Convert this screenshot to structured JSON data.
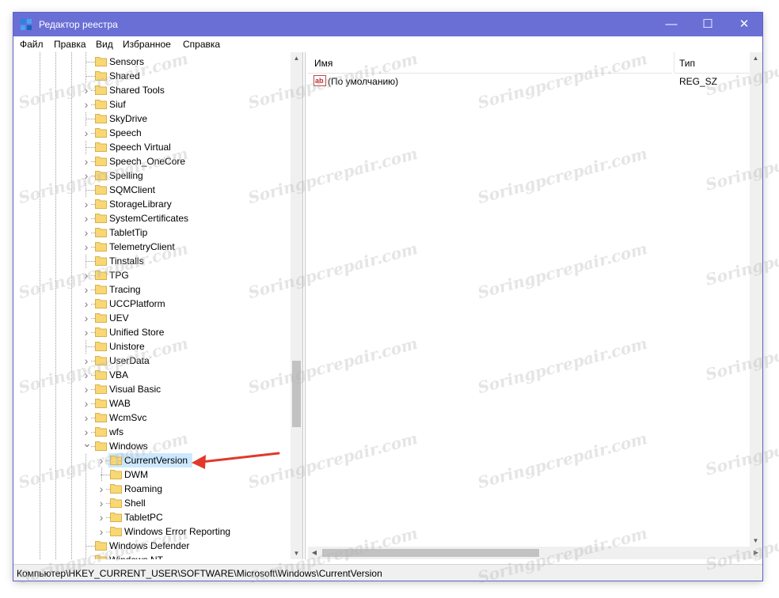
{
  "window": {
    "title": "Редактор реестра"
  },
  "menu": [
    "Файл",
    "Правка",
    "Вид",
    "Избранное",
    "Справка"
  ],
  "tree": {
    "items": [
      {
        "label": "Sensors",
        "level": 0,
        "expander": "none"
      },
      {
        "label": "Shared",
        "level": 0,
        "expander": "none"
      },
      {
        "label": "Shared Tools",
        "level": 0,
        "expander": "collapsed"
      },
      {
        "label": "Siuf",
        "level": 0,
        "expander": "collapsed"
      },
      {
        "label": "SkyDrive",
        "level": 0,
        "expander": "none"
      },
      {
        "label": "Speech",
        "level": 0,
        "expander": "collapsed"
      },
      {
        "label": "Speech Virtual",
        "level": 0,
        "expander": "none"
      },
      {
        "label": "Speech_OneCore",
        "level": 0,
        "expander": "collapsed"
      },
      {
        "label": "Spelling",
        "level": 0,
        "expander": "collapsed"
      },
      {
        "label": "SQMClient",
        "level": 0,
        "expander": "none"
      },
      {
        "label": "StorageLibrary",
        "level": 0,
        "expander": "collapsed"
      },
      {
        "label": "SystemCertificates",
        "level": 0,
        "expander": "collapsed"
      },
      {
        "label": "TabletTip",
        "level": 0,
        "expander": "collapsed"
      },
      {
        "label": "TelemetryClient",
        "level": 0,
        "expander": "collapsed"
      },
      {
        "label": "Tinstalls",
        "level": 0,
        "expander": "none"
      },
      {
        "label": "TPG",
        "level": 0,
        "expander": "collapsed"
      },
      {
        "label": "Tracing",
        "level": 0,
        "expander": "collapsed"
      },
      {
        "label": "UCCPlatform",
        "level": 0,
        "expander": "collapsed"
      },
      {
        "label": "UEV",
        "level": 0,
        "expander": "collapsed"
      },
      {
        "label": "Unified Store",
        "level": 0,
        "expander": "collapsed"
      },
      {
        "label": "Unistore",
        "level": 0,
        "expander": "none"
      },
      {
        "label": "UserData",
        "level": 0,
        "expander": "collapsed"
      },
      {
        "label": "VBA",
        "level": 0,
        "expander": "collapsed"
      },
      {
        "label": "Visual Basic",
        "level": 0,
        "expander": "collapsed"
      },
      {
        "label": "WAB",
        "level": 0,
        "expander": "collapsed"
      },
      {
        "label": "WcmSvc",
        "level": 0,
        "expander": "collapsed"
      },
      {
        "label": "wfs",
        "level": 0,
        "expander": "collapsed"
      },
      {
        "label": "Windows",
        "level": 0,
        "expander": "expanded"
      },
      {
        "label": "CurrentVersion",
        "level": 1,
        "expander": "collapsed",
        "selected": true
      },
      {
        "label": "DWM",
        "level": 1,
        "expander": "none"
      },
      {
        "label": "Roaming",
        "level": 1,
        "expander": "collapsed"
      },
      {
        "label": "Shell",
        "level": 1,
        "expander": "collapsed"
      },
      {
        "label": "TabletPC",
        "level": 1,
        "expander": "collapsed"
      },
      {
        "label": "Windows Error Reporting",
        "level": 1,
        "expander": "collapsed"
      },
      {
        "label": "Windows Defender",
        "level": 0,
        "expander": "none"
      },
      {
        "label": "Windows NT",
        "level": 0,
        "expander": "none"
      }
    ]
  },
  "values": {
    "columns": {
      "name": "Имя",
      "type": "Тип"
    },
    "rows": [
      {
        "name": "(По умолчанию)",
        "type": "REG_SZ"
      }
    ]
  },
  "status": {
    "path": "Компьютер\\HKEY_CURRENT_USER\\SOFTWARE\\Microsoft\\Windows\\CurrentVersion"
  },
  "watermark": {
    "text": "Soringpcrepair.com"
  },
  "colors": {
    "titlebar": "#6a6fd6",
    "selection": "#cce8ff",
    "folder": "#f8d775",
    "arrow": "#e0392b"
  }
}
